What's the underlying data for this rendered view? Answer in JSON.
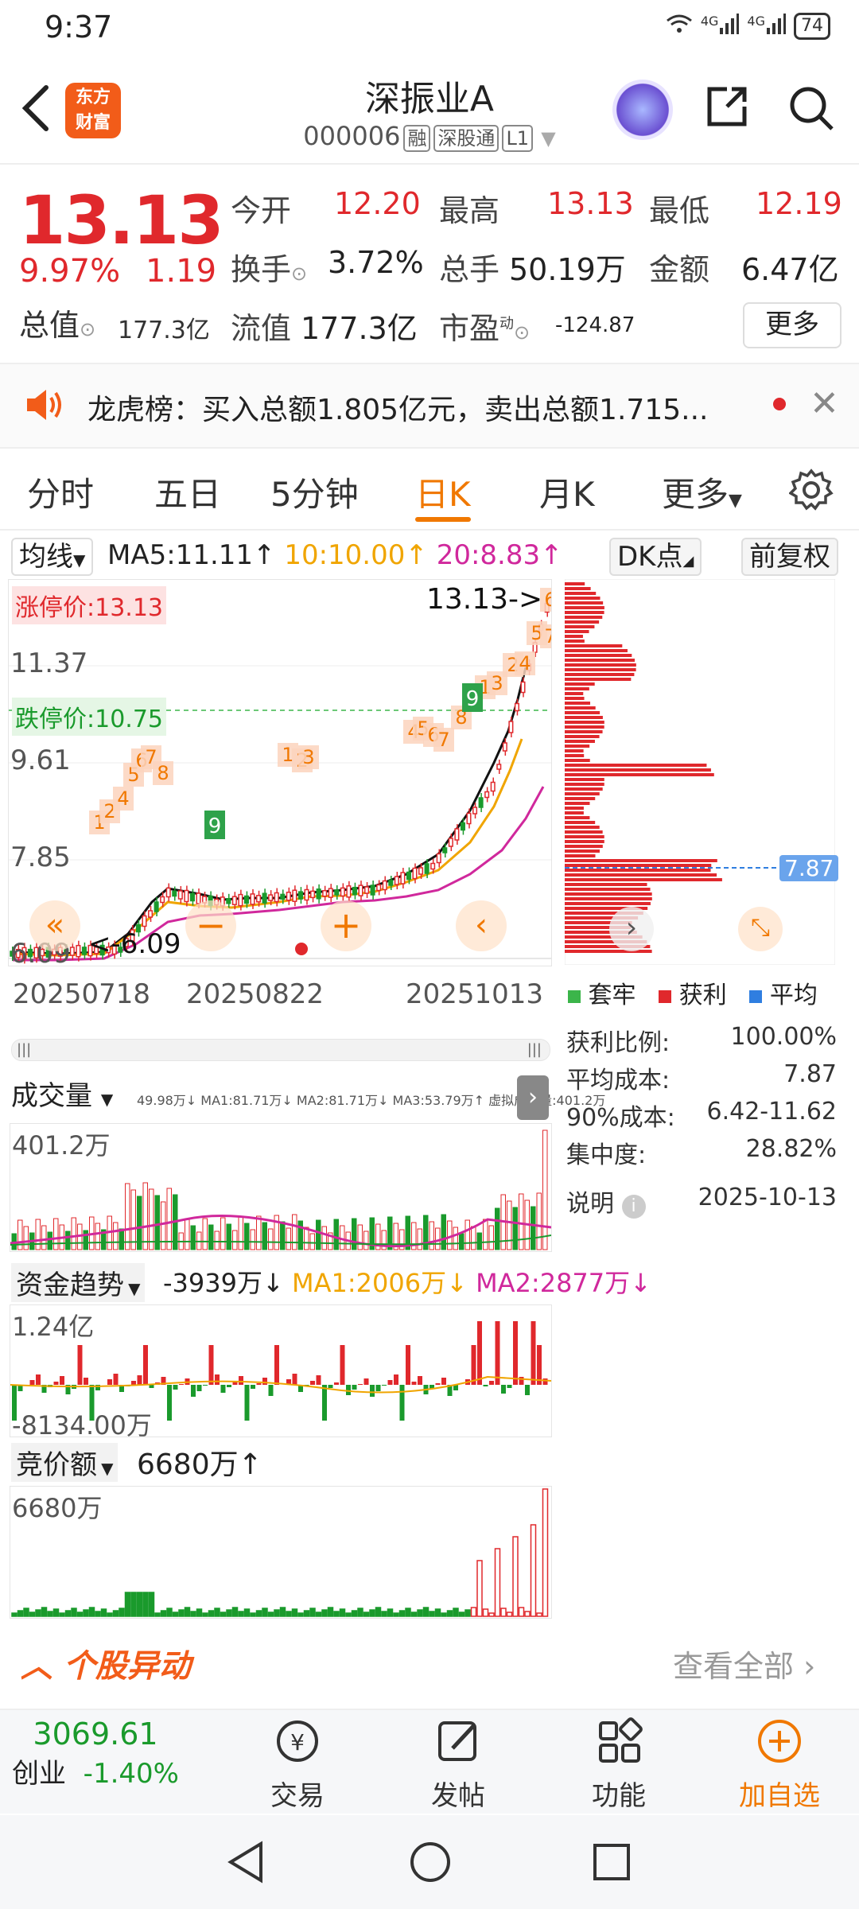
{
  "status": {
    "time": "9:37",
    "net1": "4G",
    "net2": "4G",
    "battery": "74"
  },
  "header": {
    "logo_line1": "东方",
    "logo_line2": "财富",
    "name": "深振业A",
    "code": "000006",
    "tags": [
      "融",
      "深股通",
      "L1"
    ]
  },
  "quote": {
    "price": "13.13",
    "change_pct": "9.97%",
    "change": "1.19",
    "open_label": "今开",
    "open": "12.20",
    "high_label": "最高",
    "high": "13.13",
    "low_label": "最低",
    "low": "12.19",
    "turnover_label": "换手",
    "turnover": "3.72%",
    "volume_label": "总手",
    "volume": "50.19万",
    "amount_label": "金额",
    "amount": "6.47亿",
    "mktcap_label": "总值",
    "mktcap": "177.3亿",
    "float_label": "流值",
    "float": "177.3亿",
    "pe_label": "市盈",
    "pe_sup": "动",
    "pe": "-124.87",
    "more": "更多"
  },
  "notice": {
    "text": "龙虎榜：买入总额1.805亿元，卖出总额1.715..."
  },
  "tabs": [
    "分时",
    "五日",
    "5分钟",
    "日K",
    "月K",
    "更多"
  ],
  "kline": {
    "ma_type": "均线",
    "ma5": "MA5:11.11↑",
    "ma10": "10:10.00↑",
    "ma20": "20:8.83↑",
    "dk": "DK点",
    "fq": "前复权",
    "limit_up": "涨停价:13.13",
    "limit_down": "跌停价:10.75",
    "last_price": "13.13->",
    "min_price": "<-6.09",
    "y_labels": [
      "11.37",
      "9.61",
      "7.85",
      "6.09"
    ],
    "x_labels": [
      "20250718",
      "20250822",
      "20251013"
    ]
  },
  "chips": {
    "avg_cost_tag": "7.87",
    "legend": [
      "套牢",
      "获利",
      "平均"
    ],
    "rows": [
      {
        "label": "获利比例:",
        "value": "100.00%"
      },
      {
        "label": "平均成本:",
        "value": "7.87"
      },
      {
        "label": "90%成本:",
        "value": "6.42-11.62"
      },
      {
        "label": "集中度:",
        "value": "28.82%"
      }
    ],
    "note": "说明",
    "date": "2025-10-13",
    "colors": {
      "trapped": "#3bb54a",
      "profit": "#e0282c",
      "average": "#2f7ee0"
    }
  },
  "volume": {
    "title": "成交量",
    "line": "49.98万↓ MA1:81.71万↓ MA2:81.71万↓ MA3:53.79万↑ 虚拟成交量:401.2万",
    "max": "401.2万"
  },
  "fund": {
    "title": "资金趋势",
    "val": "-3939万↓",
    "ma1": "MA1:2006万↓",
    "ma2": "MA2:2877万↓",
    "top": "1.24亿",
    "bottom": "-8134.00万"
  },
  "auction": {
    "title": "竞价额",
    "val": "6680万↑",
    "max": "6680万"
  },
  "movement": {
    "title": "个股异动",
    "link": "查看全部"
  },
  "bottom_nav": {
    "index_value": "3069.61",
    "index_name": "创业",
    "index_pct": "-1.40%",
    "items": [
      "交易",
      "发帖",
      "功能",
      "加自选"
    ]
  }
}
